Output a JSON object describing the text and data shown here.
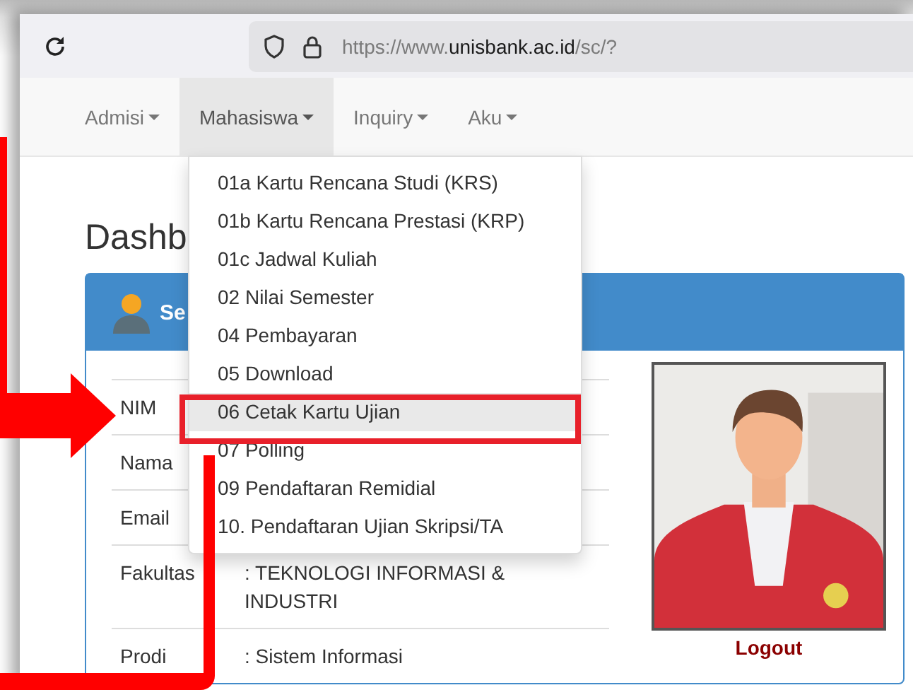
{
  "browser": {
    "url": {
      "prefix": "https://www.",
      "domain": "unisbank.ac.id",
      "path": "/sc/?"
    }
  },
  "nav": [
    {
      "label": "Admisi",
      "selected": false
    },
    {
      "label": "Mahasiswa",
      "selected": true
    },
    {
      "label": "Inquiry",
      "selected": false
    },
    {
      "label": "Aku",
      "selected": false
    }
  ],
  "menu": [
    {
      "label": "01a Kartu Rencana Studi (KRS)",
      "selected": false
    },
    {
      "label": "01b Kartu Rencana Prestasi (KRP)",
      "selected": false
    },
    {
      "label": "01c Jadwal Kuliah",
      "selected": false
    },
    {
      "label": "02 Nilai Semester",
      "selected": false
    },
    {
      "label": "04 Pembayaran",
      "selected": false
    },
    {
      "label": "05 Download",
      "selected": false
    },
    {
      "label": "06 Cetak Kartu Ujian",
      "selected": true
    },
    {
      "label": "07 Polling",
      "selected": false
    },
    {
      "label": "09 Pendaftaran Remidial",
      "selected": false
    },
    {
      "label": "10. Pendaftaran Ujian Skripsi/TA",
      "selected": false
    }
  ],
  "page_title": "Dashb",
  "panel": {
    "title": "Se",
    "rows": [
      {
        "label": "NIM"
      },
      {
        "label": "Nama"
      },
      {
        "label": "Email"
      },
      {
        "label": "Fakultas",
        "value": ": TEKNOLOGI INFORMASI & INDUSTRI"
      },
      {
        "label": "Prodi",
        "value": ": Sistem Informasi"
      }
    ],
    "logout": "Logout"
  }
}
